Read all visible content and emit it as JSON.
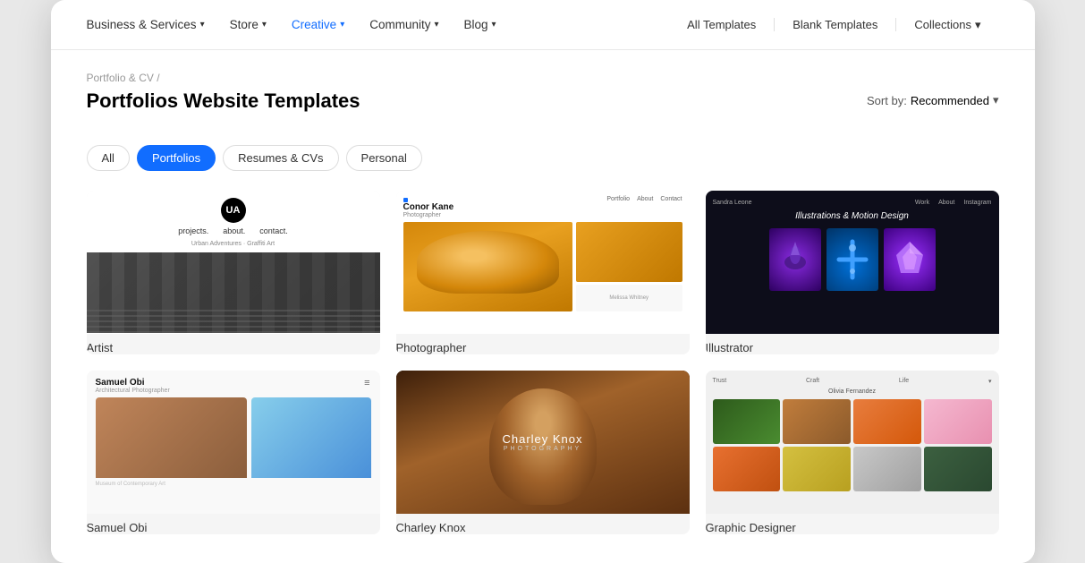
{
  "nav": {
    "left_items": [
      {
        "label": "Business & Services",
        "has_dropdown": true,
        "active": false
      },
      {
        "label": "Store",
        "has_dropdown": true,
        "active": false
      },
      {
        "label": "Creative",
        "has_dropdown": true,
        "active": true
      },
      {
        "label": "Community",
        "has_dropdown": true,
        "active": false
      },
      {
        "label": "Blog",
        "has_dropdown": true,
        "active": false
      }
    ],
    "right_items": [
      {
        "label": "All Templates",
        "has_dropdown": false
      },
      {
        "label": "Blank Templates",
        "has_dropdown": false
      },
      {
        "label": "Collections",
        "has_dropdown": true
      }
    ]
  },
  "breadcrumb": "Portfolio & CV /",
  "page_title": "Portfolios Website Templates",
  "sort_label": "Sort by:",
  "sort_value": "Recommended",
  "filter_tabs": [
    {
      "label": "All",
      "active": false
    },
    {
      "label": "Portfolios",
      "active": true
    },
    {
      "label": "Resumes & CVs",
      "active": false
    },
    {
      "label": "Personal",
      "active": false
    }
  ],
  "templates": [
    {
      "id": "artist",
      "label": "Artist"
    },
    {
      "id": "photographer",
      "label": "Photographer"
    },
    {
      "id": "illustrator",
      "label": "Illustrator"
    },
    {
      "id": "samuel",
      "label": "Samuel Obi"
    },
    {
      "id": "charley",
      "label": "Charley Knox"
    },
    {
      "id": "graphic",
      "label": "Graphic Designer"
    }
  ]
}
